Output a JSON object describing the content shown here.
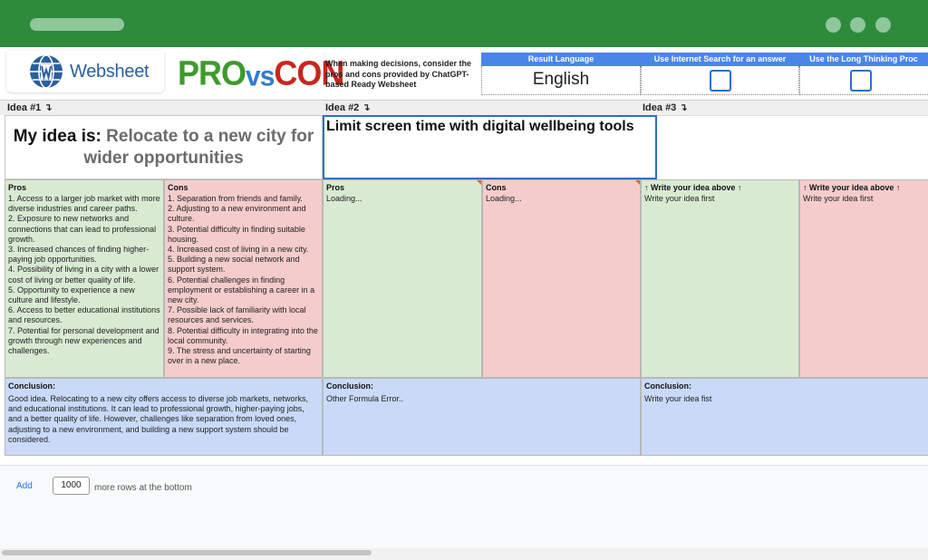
{
  "window": {
    "colors": {
      "titlebar": "#2e8b3c",
      "accent": "#4a86e8"
    }
  },
  "header": {
    "logo_text": "Websheet",
    "brand": {
      "pro": "PRO",
      "vs": "vs",
      "con": "CON"
    },
    "tagline": "When making decisions, consider the pros and cons provided by ChatGPT-based Ready Websheet",
    "options": {
      "language_label": "Result Language",
      "language_value": "English",
      "search_label": "Use Internet Search for an answer",
      "search_checked": false,
      "thinking_label": "Use the Long Thinking Proc",
      "thinking_checked": false
    }
  },
  "columns": {
    "idea1_label": "Idea #1 ↴",
    "idea2_label": "Idea #2 ↴",
    "idea3_label": "Idea #3 ↴"
  },
  "ideas": {
    "idea1_prefix": "My idea is:",
    "idea1_value": "Relocate to a new city for wider opportunities",
    "idea2_value": "Limit screen time with digital wellbeing tools",
    "idea3_value": ""
  },
  "pros_cons": {
    "idea1_pros_head": "Pros",
    "idea1_pros": [
      "1. Access to a larger job market with more diverse industries and career paths.",
      "2. Exposure to new networks and connections that can lead to professional growth.",
      "3. Increased chances of finding higher-paying job opportunities.",
      "4. Possibility of living in a city with a lower cost of living or better quality of life.",
      "5. Opportunity to experience a new culture and lifestyle.",
      "6. Access to better educational institutions and resources.",
      "7. Potential for personal development and growth through new experiences and challenges."
    ],
    "idea1_cons_head": "Cons",
    "idea1_cons": [
      "1. Separation from friends and family.",
      "2. Adjusting to a new environment and culture.",
      "3. Potential difficulty in finding suitable housing.",
      "4. Increased cost of living in a new city.",
      "5. Building a new social network and support system.",
      "6. Potential challenges in finding employment or establishing a career in a new city.",
      "7. Possible lack of familiarity with local resources and services.",
      "8. Potential difficulty in integrating into the local community.",
      "9. The stress and uncertainty of starting over in a new place."
    ],
    "idea2_pros_head": "Pros",
    "idea2_pros": "Loading...",
    "idea2_cons_head": "Cons",
    "idea2_cons": "Loading...",
    "idea3_pros_head": "↑ Write your idea above ↑",
    "idea3_pros": "Write your idea first",
    "idea3_cons_head": "↑ Write your idea above ↑",
    "idea3_cons": "Write your idea first"
  },
  "conclusions": {
    "head": "Conclusion:",
    "idea1": "Good idea. Relocating to a new city offers access to diverse job markets, networks, and educational institutions. It can lead to professional growth, higher-paying jobs, and a better quality of life. However, challenges like separation from loved ones, adjusting to a new environment, and building a new support system should be considered.",
    "idea2": "Other Formula Error..",
    "idea3": "Write your idea fist"
  },
  "footer": {
    "add_label": "Add",
    "rows_value": "1000",
    "rows_text": "more rows at the bottom"
  }
}
